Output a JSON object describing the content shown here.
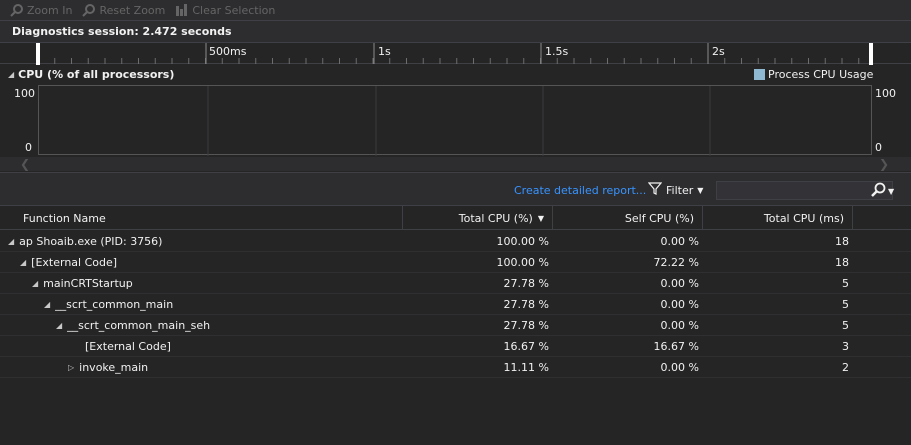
{
  "toolbar": {
    "zoom_in": "Zoom In",
    "reset_zoom": "Reset Zoom",
    "clear_selection": "Clear Selection"
  },
  "session": {
    "label": "Diagnostics session: 2.472 seconds"
  },
  "ruler": {
    "ticks": [
      "500ms",
      "1s",
      "1.5s",
      "2s"
    ]
  },
  "cpu": {
    "title": "CPU (% of all processors)",
    "legend": "Process CPU Usage",
    "legend_color": "#8fb9d2",
    "y_max": "100",
    "y_min": "0"
  },
  "filterbar": {
    "report_link": "Create detailed report...",
    "filter_label": "Filter",
    "search_placeholder": ""
  },
  "table": {
    "columns": [
      "Function Name",
      "Total CPU (%)",
      "Self CPU (%)",
      "Total CPU (ms)"
    ],
    "rows": [
      {
        "name": "ap Shoaib.exe (PID: 3756)",
        "total": "100.00 %",
        "self": "0.00 %",
        "ms": "18",
        "expander": "◢"
      },
      {
        "name": "[External Code]",
        "total": "100.00 %",
        "self": "72.22 %",
        "ms": "18",
        "expander": "◢"
      },
      {
        "name": "mainCRTStartup",
        "total": "27.78 %",
        "self": "0.00 %",
        "ms": "5",
        "expander": "◢"
      },
      {
        "name": "__scrt_common_main",
        "total": "27.78 %",
        "self": "0.00 %",
        "ms": "5",
        "expander": "◢"
      },
      {
        "name": "__scrt_common_main_seh",
        "total": "27.78 %",
        "self": "0.00 %",
        "ms": "5",
        "expander": "◢"
      },
      {
        "name": "[External Code]",
        "total": "16.67 %",
        "self": "16.67 %",
        "ms": "3",
        "expander": ""
      },
      {
        "name": "invoke_main",
        "total": "11.11 %",
        "self": "0.00 %",
        "ms": "2",
        "expander": "▷"
      }
    ]
  }
}
